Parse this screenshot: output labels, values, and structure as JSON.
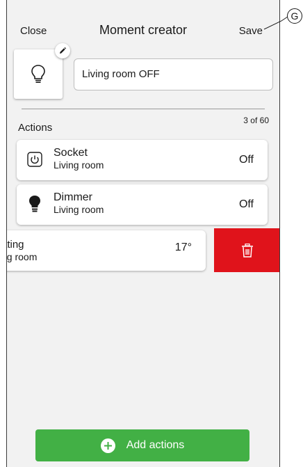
{
  "header": {
    "close_label": "Close",
    "title": "Moment creator",
    "save_label": "Save"
  },
  "moment": {
    "icon": "lightbulb-icon",
    "name_value": "Living room OFF"
  },
  "actions_section": {
    "label": "Actions",
    "count": "3 of 60"
  },
  "actions": [
    {
      "icon": "power-icon",
      "name": "Socket",
      "room": "Living room",
      "state": "Off"
    },
    {
      "icon": "bulb-icon",
      "name": "Dimmer",
      "room": "Living room",
      "state": "Off"
    },
    {
      "icon": "none",
      "name": "ating",
      "room": "ng room",
      "state": "17°"
    }
  ],
  "delete_action": {
    "icon": "trash-icon"
  },
  "add_button": {
    "label": "Add actions",
    "icon": "plus-circle-icon"
  },
  "callout": {
    "label": "G"
  },
  "colors": {
    "delete_red": "#e0131b",
    "add_green": "#42b045",
    "screen_background": "#f2f2f2"
  }
}
